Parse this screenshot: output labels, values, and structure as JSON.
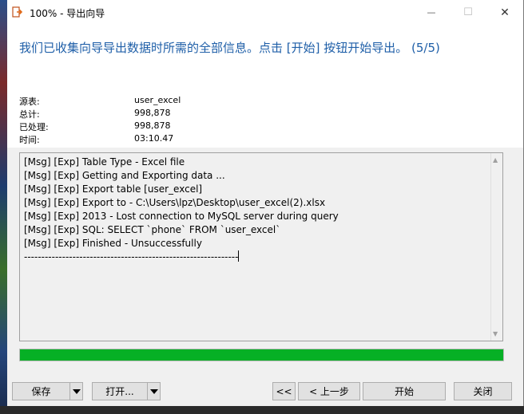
{
  "window": {
    "title": "100% - 导出向导",
    "minimize": "—",
    "maximize": "☐",
    "close": "✕"
  },
  "header": {
    "message": "我们已收集向导导出数据时所需的全部信息。点击 [开始] 按钮开始导出。 (5/5)"
  },
  "info": [
    {
      "label": "源表:",
      "value": "user_excel"
    },
    {
      "label": "总计:",
      "value": "998,878"
    },
    {
      "label": "已处理:",
      "value": "998,878"
    },
    {
      "label": "时间:",
      "value": "03:10.47"
    }
  ],
  "log": [
    "[Msg] [Exp] Table Type - Excel file",
    "[Msg] [Exp] Getting and Exporting data ...",
    "[Msg] [Exp] Export table [user_excel]",
    "[Msg] [Exp] Export to - C:\\Users\\lpz\\Desktop\\user_excel(2).xlsx",
    "[Msg] [Exp] 2013 - Lost connection to MySQL server during query",
    "[Msg] [Exp] SQL: SELECT `phone` FROM `user_excel`",
    "[Msg] [Exp] Finished - Unsuccessfully",
    "--------------------------------------------------------------"
  ],
  "progress": {
    "percent": 100,
    "color": "#06b025"
  },
  "buttons": {
    "save": "保存",
    "open": "打开...",
    "first": "<<",
    "back": "< 上一步",
    "start": "开始",
    "close": "关闭"
  },
  "colors": {
    "accent": "#1f5fa8"
  }
}
